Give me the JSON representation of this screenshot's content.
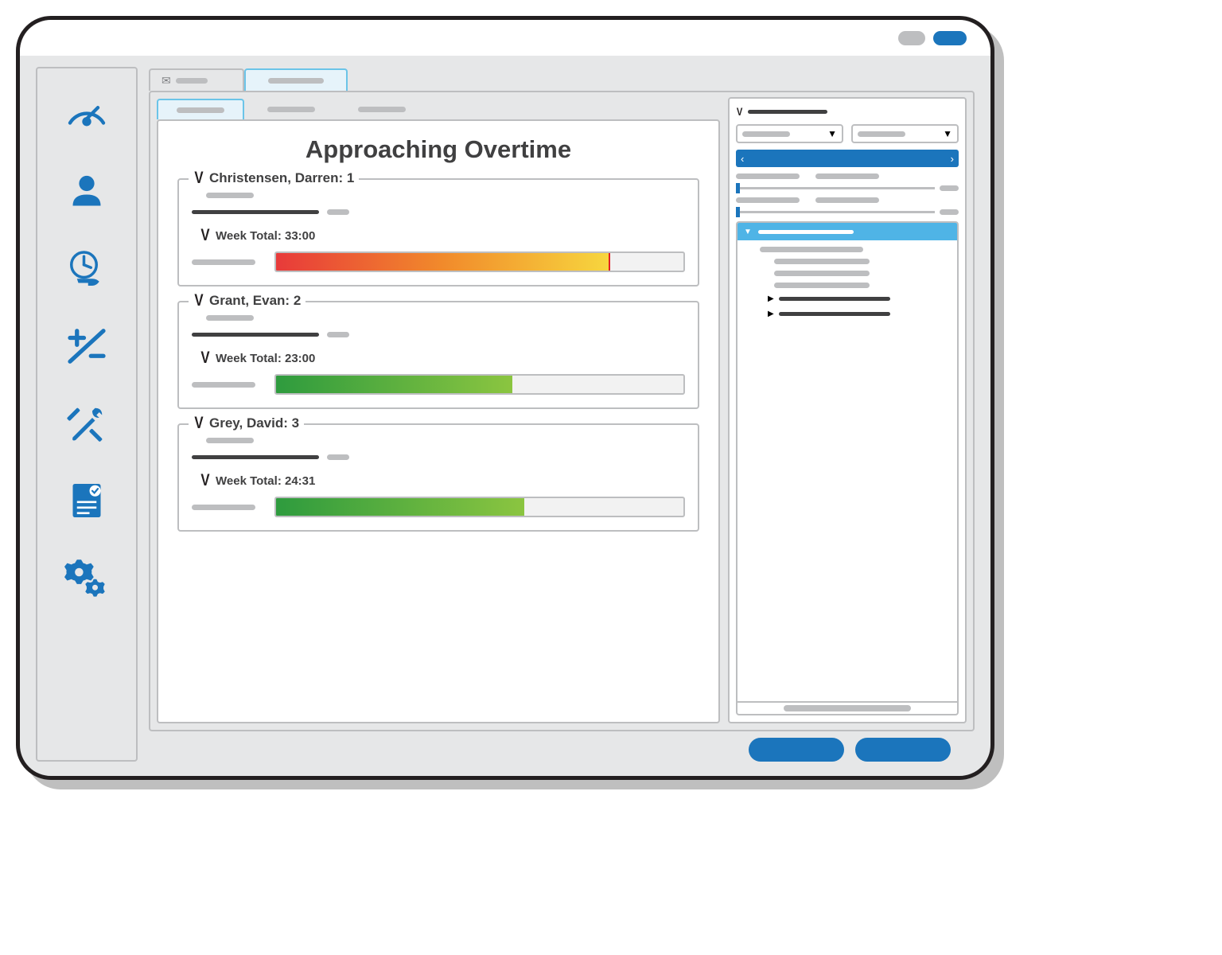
{
  "colors": {
    "accent": "#1b75bc",
    "accent_light": "#4fb4e6"
  },
  "main": {
    "title": "Approaching Overtime",
    "employees": [
      {
        "name": "Christensen, Darren: 1",
        "week_total": "Week Total: 33:00",
        "percent": 82,
        "gradient": "redorange"
      },
      {
        "name": "Grant, Evan: 2",
        "week_total": "Week Total: 23:00",
        "percent": 58,
        "gradient": "green"
      },
      {
        "name": "Grey, David: 3",
        "week_total": "Week Total: 24:31",
        "percent": 61,
        "gradient": "green"
      }
    ]
  }
}
